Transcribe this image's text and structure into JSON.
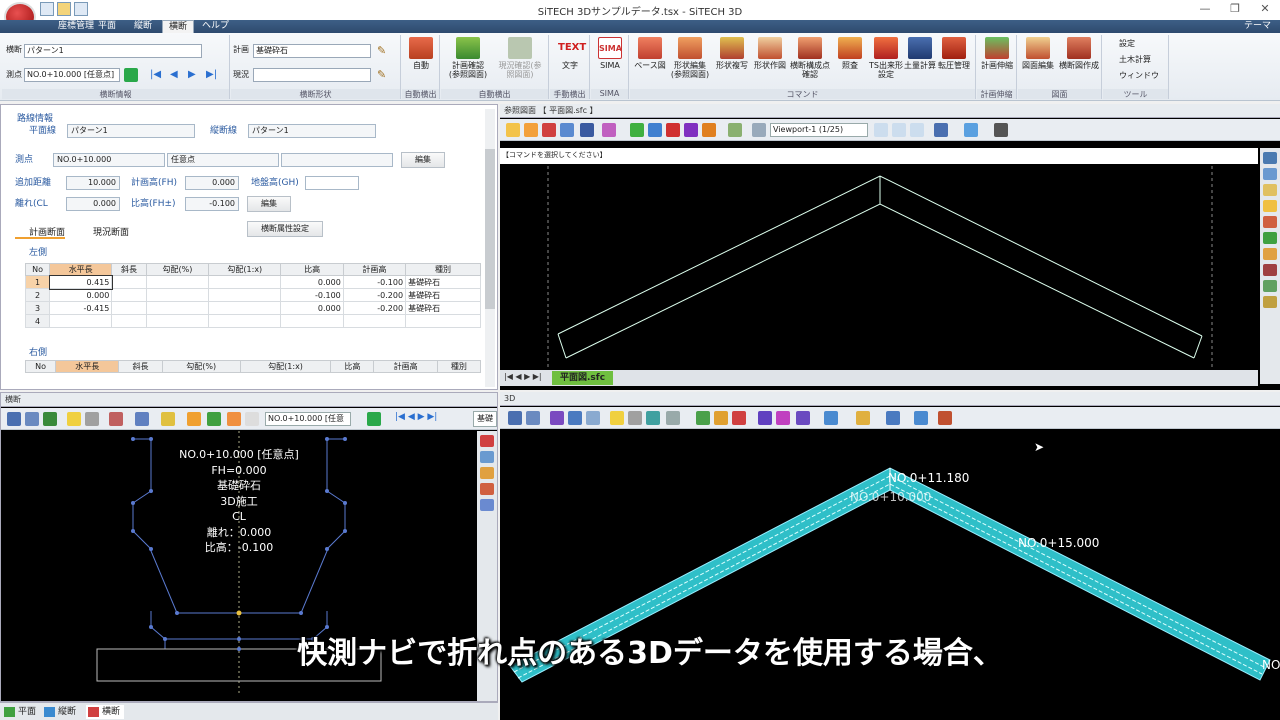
{
  "window": {
    "title": "SiTECH 3Dサンプルデータ.tsx - SiTECH 3D",
    "theme": "テーマ"
  },
  "menubar": [
    {
      "label": "座標管理"
    },
    {
      "label": "平面"
    },
    {
      "label": "縦断"
    },
    {
      "label": "横断",
      "active": true
    },
    {
      "label": "ヘルプ"
    }
  ],
  "ribbon": {
    "oudan_label": "横断",
    "pattern_value": "パターン1",
    "sokuten_label": "測点",
    "sokuten_value": "NO.0+10.000 [任意点]",
    "keikaku_label": "計画",
    "keikaku_value": "基礎砕石",
    "genkyo_label": "現況",
    "genkyo_value": "",
    "groups": [
      "横断情報",
      "横断形状",
      "自動横出",
      "自動横出",
      "手動横出",
      "SIMA",
      "コマンド",
      "計画伸縮",
      "図面",
      "ツール"
    ],
    "buttons": {
      "jido": "自動",
      "keikaku_kakunin": "計画確認(参照図面)",
      "genkyo_kakunin": "現況確認(参照図面)",
      "moji": "文字",
      "sima": "SIMA",
      "base": "ベース図",
      "keijo_henshu": "形状編集(参照図面)",
      "keijo_fukusha": "形状複写",
      "keijo_sakuzu": "形状作図",
      "oudan_kousei": "横断構成点確認",
      "shoukou": "照査",
      "ts_shutsukei": "TS出来形設定",
      "doryo": "土量計算",
      "tenkai": "転圧管理",
      "keikaku_shinshuku": "計画伸縮",
      "zumen_henshu": "図面編集",
      "oudanzu": "横断図作成",
      "settei": "設定",
      "doboku": "土木計算",
      "window": "ウィンドウ"
    }
  },
  "route_info": {
    "section_title": "路線情報",
    "heimen_label": "平面線",
    "heimen_value": "パターン1",
    "judan_label": "縦断線",
    "judan_value": "パターン1",
    "sokuten_label": "測点",
    "sokuten_value": "NO.0+10.000",
    "sokuten_type": "任意点",
    "henshu1": "編集",
    "tsuika_label": "追加距離",
    "tsuika_value": "10.000",
    "keikaku_fh_label": "計画高(FH)",
    "keikaku_fh_value": "0.000",
    "jiban_label": "地盤高(GH)",
    "jiban_value": "",
    "hanare_label": "離れ(CL",
    "hanare_value": "0.000",
    "hikou_label": "比高(FH±)",
    "hikou_value": "-0.100",
    "henshu2": "編集",
    "tab_keikaku": "計画断面",
    "tab_genkyo": "現況断面",
    "attr_button": "横断属性設定",
    "left_label": "左側",
    "right_label": "右側"
  },
  "grid": {
    "headers": [
      "No",
      "水平長",
      "斜長",
      "勾配(%)",
      "勾配(1:x)",
      "比高",
      "計画高",
      "種別"
    ],
    "rows": [
      [
        "1",
        "0.415",
        "",
        "",
        "",
        "0.000",
        "-0.100",
        "基礎砕石"
      ],
      [
        "2",
        "0.000",
        "",
        "",
        "",
        "-0.100",
        "-0.200",
        "基礎砕石"
      ],
      [
        "3",
        "-0.415",
        "",
        "",
        "",
        "0.000",
        "-0.200",
        "基礎砕石"
      ],
      [
        "4",
        "",
        "",
        "",
        "",
        "",
        "",
        ""
      ]
    ]
  },
  "ref_panel": {
    "title": "参照図面 【 平面図.sfc 】",
    "viewport": "Viewport-1 (1/25)",
    "prompt": "【コマンドを選択してください】",
    "tab": "平面図.sfc"
  },
  "cross_panel": {
    "title": "横断",
    "sokuten": "NO.0+10.000 [任意",
    "kiso": "基礎",
    "info": [
      "NO.0+10.000 [任意点]",
      "FH=0.000",
      "基礎砕石",
      "3D施工",
      "CL",
      "離れ：0.000",
      "比高：-0.100"
    ]
  },
  "panel3d": {
    "title": "3D",
    "labels": [
      "NO.0+11.180",
      "NO.0+10.000",
      "NO.0+15.000",
      "NO."
    ]
  },
  "status_tabs": [
    "平面",
    "縦断",
    "横断"
  ],
  "subtitle": "快測ナビで折れ点のある3Dデータを使用する場合、"
}
